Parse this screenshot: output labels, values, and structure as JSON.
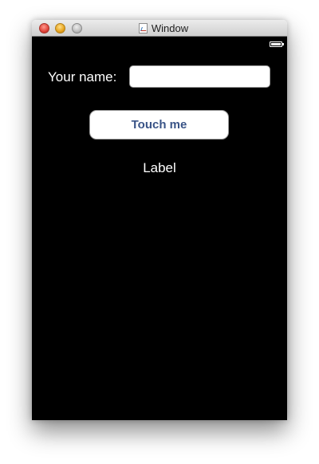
{
  "window": {
    "title": "Window",
    "title_icon": "document-app-icon",
    "controls": [
      "close-button",
      "minimize-button",
      "zoom-button"
    ]
  },
  "status_bar": {
    "battery_icon": "battery-icon",
    "battery_level": 1.0
  },
  "form": {
    "name_label": "Your name:",
    "name_value": "",
    "button_label": "Touch me",
    "output_label": "Label"
  },
  "colors": {
    "screen_background": "#000000",
    "button_text": "#3a5487",
    "label_text": "#ffffff"
  }
}
